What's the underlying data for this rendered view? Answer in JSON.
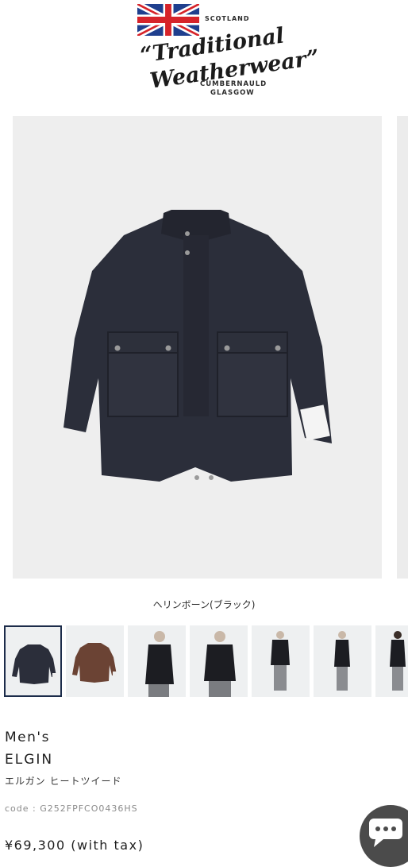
{
  "header": {
    "region": "SCOTLAND",
    "brand_line1": "“Traditional",
    "brand_line2": "Weatherwear”",
    "city_line1": "CUMBERNAULD",
    "city_line2": "GLASGOW",
    "flag_icon": "union-jack-flag",
    "colors": {
      "flag_red": "#d6232a",
      "flag_blue": "#1f3f8e"
    }
  },
  "gallery": {
    "selected_color_name": "ヘリンボーン(ブラック)",
    "thumbnails": [
      {
        "name": "black-coat-flat",
        "selected": true
      },
      {
        "name": "brown-coat-flat",
        "selected": false
      },
      {
        "name": "model-front",
        "selected": false
      },
      {
        "name": "model-front-closeup",
        "selected": false
      },
      {
        "name": "model-full-front",
        "selected": false
      },
      {
        "name": "model-full-side",
        "selected": false
      },
      {
        "name": "model-full-back",
        "selected": false
      }
    ]
  },
  "product": {
    "category": "Men's",
    "name": "ELGIN",
    "name_kana": "エルガン ヒートツイード",
    "code": "code : G252FPFCO0436HS",
    "price": "¥69,300 (with tax)"
  },
  "chat": {
    "icon": "chat-bubble-icon"
  }
}
